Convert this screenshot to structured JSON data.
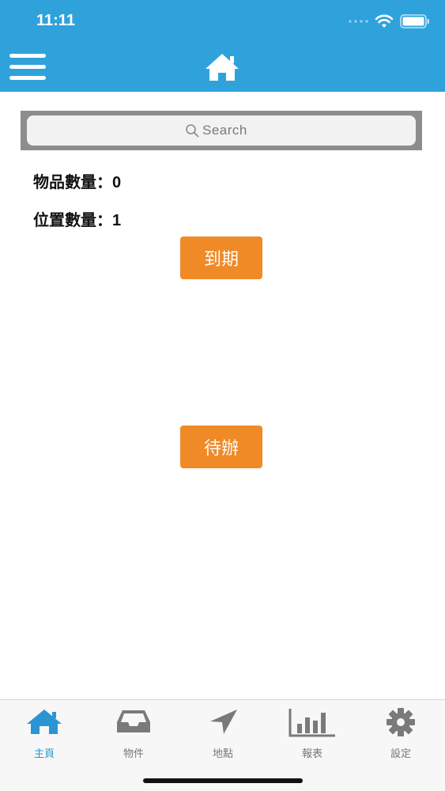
{
  "status_bar": {
    "time": "11:11"
  },
  "header": {
    "menu_icon": "hamburger-menu-icon",
    "home_icon": "home-icon"
  },
  "search": {
    "placeholder": "Search",
    "value": ""
  },
  "counts": {
    "items_label": "物品數量：",
    "items_value": "0",
    "locations_label": "位置數量：",
    "locations_value": "1"
  },
  "buttons": {
    "expiry": "到期",
    "todo": "待辦"
  },
  "tabs": [
    {
      "label": "主頁",
      "icon": "home-icon",
      "active": true
    },
    {
      "label": "物件",
      "icon": "inbox-tray-icon",
      "active": false
    },
    {
      "label": "地點",
      "icon": "location-arrow-icon",
      "active": false
    },
    {
      "label": "報表",
      "icon": "bar-chart-icon",
      "active": false
    },
    {
      "label": "設定",
      "icon": "gear-icon",
      "active": false
    }
  ],
  "colors": {
    "header_bg": "#2fa2dc",
    "button_bg": "#ef8a26",
    "tab_active": "#2b95d4",
    "tab_inactive": "#777777"
  }
}
